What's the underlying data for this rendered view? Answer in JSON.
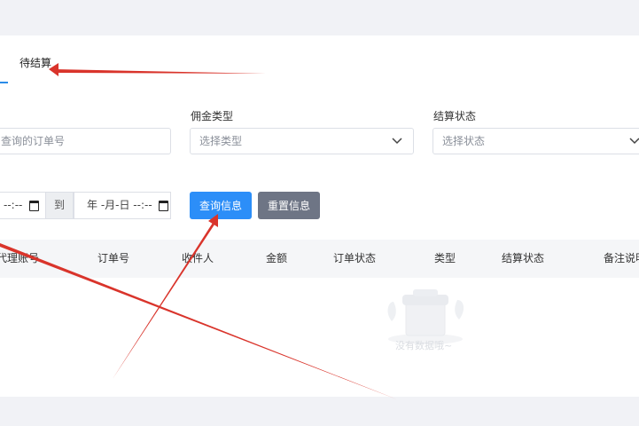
{
  "tabs": [
    {
      "label": "待结算"
    }
  ],
  "filters": {
    "order_search": {
      "placeholder": "查询的订单号"
    },
    "commission_type": {
      "label": "佣金类型",
      "placeholder": "选择类型"
    },
    "settlement_status": {
      "label": "结算状态",
      "placeholder": "选择状态"
    },
    "date_start": {
      "value": "--:-- "
    },
    "date_separator": "到",
    "date_end": {
      "value": "年 -月-日 --:-- "
    }
  },
  "buttons": {
    "query": "查询信息",
    "reset": "重置信息"
  },
  "table": {
    "columns": [
      "代理账号",
      "订单号",
      "收件人",
      "金额",
      "订单状态",
      "类型",
      "结算状态",
      "备注说明"
    ],
    "empty_text": "没有数据哦~"
  },
  "colors": {
    "primary": "#2c8ef8",
    "secondary": "#6e7585",
    "annotation_arrow": "#d9342b"
  }
}
